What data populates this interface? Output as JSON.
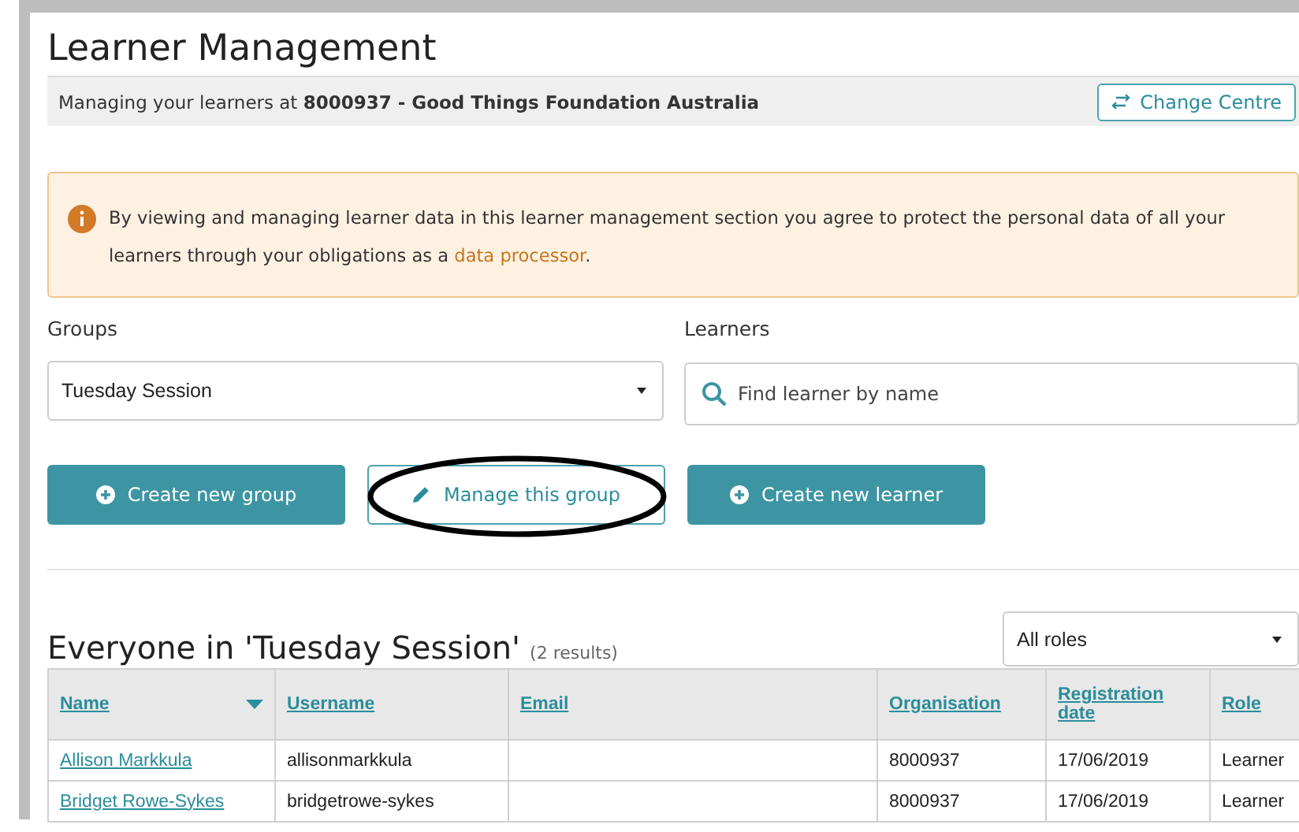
{
  "header": {
    "title": "Learner Management",
    "centre_text": "Managing your learners at **8000937 - Good Things Foundation Australia**",
    "change_button": "Change Centre"
  },
  "notice": {
    "text": "By viewing and managing learner data in this learner management section you agree to protect the personal data of all your learners through your obligations as a ",
    "link": "data processor",
    "after": "."
  },
  "groups": {
    "label": "Groups",
    "value": "Tuesday Session"
  },
  "learners": {
    "label": "Learners",
    "placeholder": "Find learner by name"
  },
  "buttons": [
    {
      "label": "Create new group",
      "kind": "primary",
      "circled": false
    },
    {
      "label": "Manage this group",
      "kind": "outline",
      "circled": true
    },
    {
      "label": "Create new learner",
      "kind": "primary",
      "circled": false
    }
  ],
  "list": {
    "title": "Everyone in 'Tuesday Session'",
    "count": "(2 results)",
    "role_filter": "All roles"
  },
  "table": {
    "columns": [
      {
        "label": "Name",
        "sorted": true
      },
      {
        "label": "Username",
        "sorted": false
      },
      {
        "label": "Email",
        "sorted": false
      },
      {
        "label": "Organisation",
        "sorted": false
      },
      {
        "label": "Registration date",
        "sorted": false
      },
      {
        "label": "Role",
        "sorted": false
      }
    ],
    "rows": [
      [
        "Allison Markkula",
        "allisonmarkkula",
        "",
        "8000937",
        "17/06/2019",
        "Learner"
      ],
      [
        "Bridget Rowe-Sykes",
        "bridgetrowe-sykes",
        "",
        "8000937",
        "17/06/2019",
        "Learner"
      ]
    ]
  }
}
